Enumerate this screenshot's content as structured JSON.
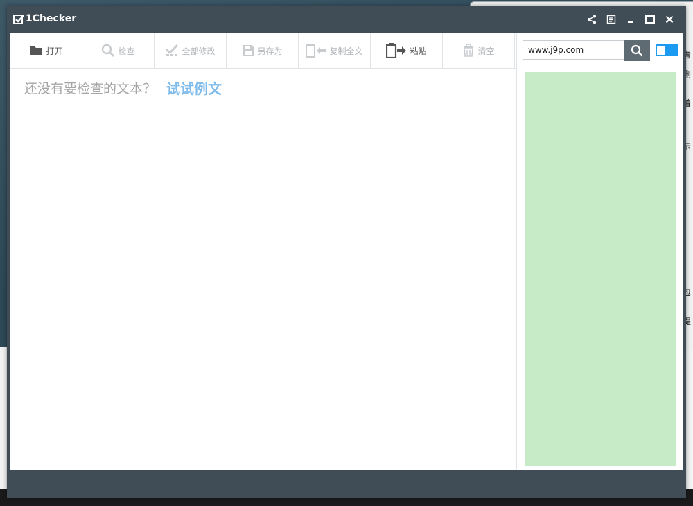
{
  "window": {
    "title": "1Checker"
  },
  "toolbar": {
    "buttons": [
      {
        "label": "打开",
        "icon": "folder-icon",
        "enabled": true
      },
      {
        "label": "检查",
        "icon": "magnifier-icon",
        "enabled": false
      },
      {
        "label": "全部修改",
        "icon": "checkmarks-icon",
        "enabled": false
      },
      {
        "label": "另存为",
        "icon": "floppy-icon",
        "enabled": false
      },
      {
        "label": "复制全文",
        "icon": "clipboard-copy-icon",
        "enabled": false
      },
      {
        "label": "粘贴",
        "icon": "clipboard-paste-icon",
        "enabled": true
      },
      {
        "label": "清空",
        "icon": "trash-icon",
        "enabled": false
      }
    ]
  },
  "editor": {
    "prompt": "还没有要检查的文本？",
    "try_link": "试试例文"
  },
  "sidebar": {
    "search_value": "www.j9p.com",
    "toggle_on": true
  },
  "colors": {
    "titlebar": "#414d56",
    "link": "#7fbcec",
    "toggle_accent": "#1a9af0",
    "ad_background": "#c6ebc6",
    "search_button": "#5f6b73"
  },
  "background_window": {
    "fragments": [
      "青",
      "删",
      "着",
      "示",
      "。",
      "包",
      "。",
      "提",
      "、"
    ]
  }
}
